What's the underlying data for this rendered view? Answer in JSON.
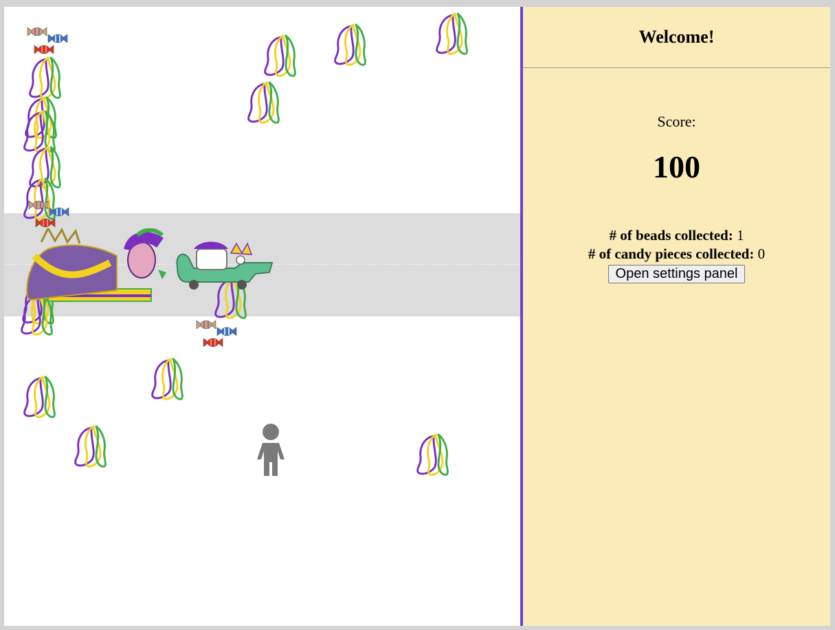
{
  "panel": {
    "title": "Welcome!",
    "score_label": "Score:",
    "score_value": "100",
    "beads_label": "# of beads collected:",
    "beads_count": "1",
    "candy_label": "# of candy pieces collected:",
    "candy_count": "0",
    "settings_button": "Open settings panel"
  },
  "icons": {
    "bead": "bead-necklace-icon",
    "candy": "candy-icon",
    "player": "person-icon",
    "float": "parade-float",
    "gator": "gator-float"
  },
  "colors": {
    "purple": "#7b2fbf",
    "gold": "#f2d21e",
    "green": "#3fae49",
    "divider": "#6a40d8",
    "panel_bg": "#faebb8",
    "lane_bg": "#dcdcdc",
    "player": "#7a7a7a"
  }
}
